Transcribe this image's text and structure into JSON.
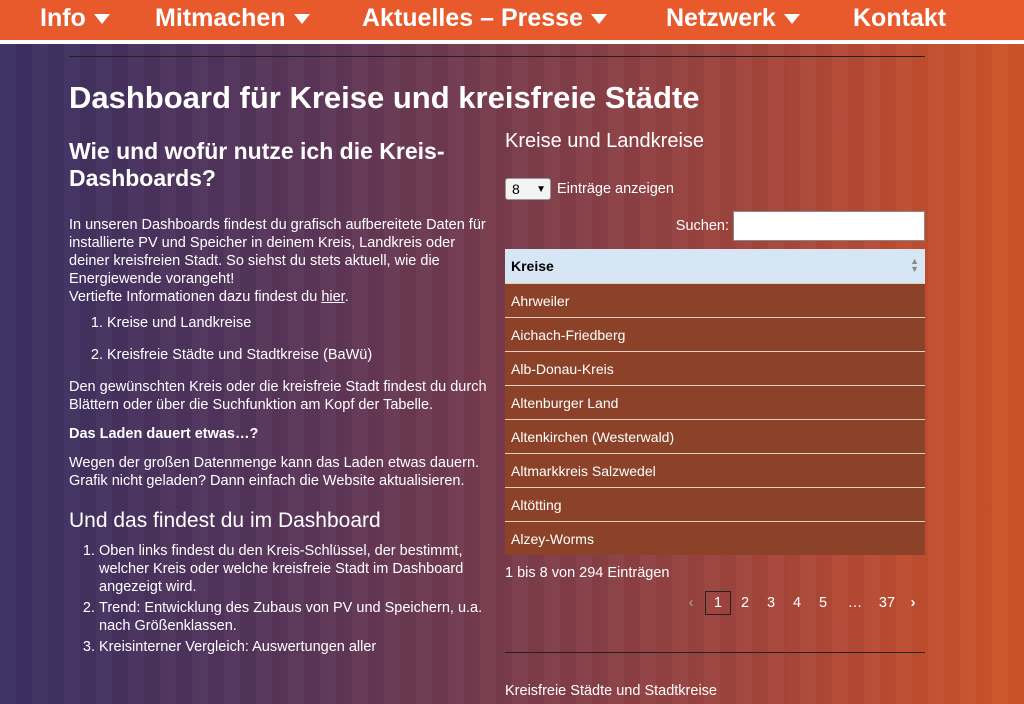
{
  "nav": {
    "info": "Info",
    "mitmachen": "Mitmachen",
    "aktuelles": "Aktuelles – Presse",
    "netzwerk": "Netzwerk",
    "kontakt": "Kontakt"
  },
  "page": {
    "title": "Dashboard für Kreise und kreisfreie Städte"
  },
  "left": {
    "heading": "Wie und wofür nutze ich die Kreis-Dashboards?",
    "intro": "In unseren Dashboards findest du grafisch aufbereitete Daten für installierte PV und Speicher in deinem Kreis, Landkreis oder deiner kreisfreien Stadt. So siehst du stets aktuell, wie die Energiewende vorangeht!",
    "more_prefix": "Vertiefte Informationen dazu findest du ",
    "more_link": "hier",
    "more_suffix": ".",
    "list": [
      "Kreise und Landkreise",
      "Kreisfreie Städte und Stadtkreise (BaWü)"
    ],
    "find_text": "Den gewünschten Kreis oder die kreisfreie Stadt findest du durch Blättern oder über die Suchfunktion am Kopf der Tabelle.",
    "loading_heading": "Das Laden dauert etwas…?",
    "loading_text": "Wegen der großen Datenmenge kann das Laden etwas dauern. Grafik nicht geladen? Dann einfach die Website aktualisieren.",
    "section2": "Und das findest du im Dashboard",
    "list2": [
      "Oben links findest du den Kreis-Schlüssel, der bestimmt, welcher Kreis oder welche kreisfreie Stadt im Dashboard angezeigt wird.",
      "Trend: Entwicklung des Zubaus von PV und Speichern, u.a. nach Größenklassen.",
      "Kreisinterner Vergleich: Auswertungen aller"
    ]
  },
  "table": {
    "heading": "Kreise und Landkreise",
    "length_value": "8",
    "length_label": "Einträge anzeigen",
    "search_label": "Suchen:",
    "search_value": "",
    "column": "Kreise",
    "rows": [
      "Ahrweiler",
      "Aichach-Friedberg",
      "Alb-Donau-Kreis",
      "Altenburger Land",
      "Altenkirchen (Westerwald)",
      "Altmarkkreis Salzwedel",
      "Altötting",
      "Alzey-Worms"
    ],
    "info": "1 bis 8 von 294 Einträgen",
    "pages": [
      "1",
      "2",
      "3",
      "4",
      "5",
      "…",
      "37"
    ],
    "prev": "‹",
    "next": "›"
  },
  "bottom": {
    "subheading": "Kreisfreie Städte und Stadtkreise"
  }
}
